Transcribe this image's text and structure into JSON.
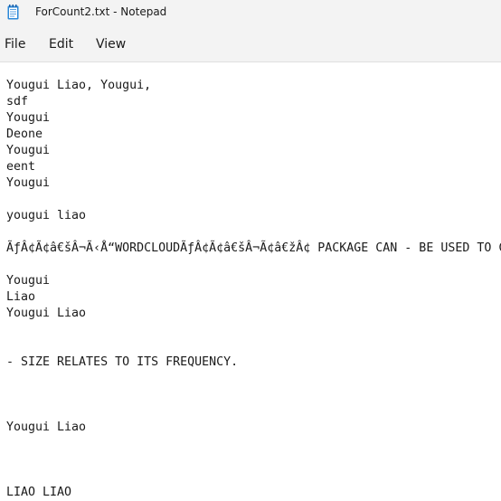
{
  "window": {
    "title": "ForCount2.txt - Notepad",
    "icon": "notepad-icon"
  },
  "menu": {
    "file": "File",
    "edit": "Edit",
    "view": "View"
  },
  "editor": {
    "content": "Yougui Liao, Yougui,\nsdf\nYougui\nDeone\nYougui\neent\nYougui\n\nyougui liao\n\nÃƒÂ¢Ã¢â€šÂ¬Ã‹Å“WORDCLOUDÃƒÂ¢Ã¢â€šÂ¬Ã¢â€žÂ¢ PACKAGE CAN - BE USED TO CREATE\n\nYougui\nLiao\nYougui Liao\n\n\n- SIZE RELATES TO ITS FREQUENCY.\n\n\n\nYougui Liao\n\n\n\nLIAO LIAO"
  }
}
